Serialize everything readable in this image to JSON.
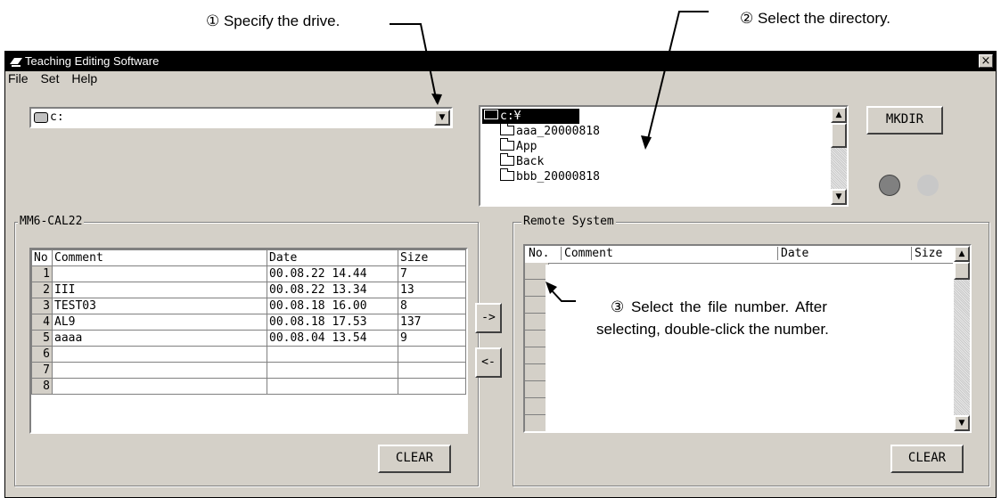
{
  "annotations": {
    "step1": "① Specify the drive.",
    "step2": "② Select the directory.",
    "step3_line1": "③  Select the file number. After",
    "step3_line2": "selecting, double-click the number."
  },
  "window": {
    "title": "Teaching Editing Software",
    "close_glyph": "×"
  },
  "menu": [
    "File",
    "Set",
    "Help"
  ],
  "drive": {
    "value": "c:",
    "arrow": "▼"
  },
  "directory": {
    "root": "c:¥",
    "items": [
      "aaa_20000818",
      "App",
      "Back",
      "bbb_20000818"
    ],
    "up": "▲",
    "down": "▼"
  },
  "mkdir_label": "MKDIR",
  "status_colors": {
    "light1": "#808080",
    "light2": "#c8c8c8"
  },
  "local": {
    "group_label": "MM6-CAL22",
    "columns": [
      "No",
      "Comment",
      "Date",
      "Size"
    ],
    "rows": [
      {
        "no": "1",
        "comment": "",
        "date": "00.08.22 14.44",
        "size": "7"
      },
      {
        "no": "2",
        "comment": "III",
        "date": "00.08.22 13.34",
        "size": "13"
      },
      {
        "no": "3",
        "comment": "TEST03",
        "date": "00.08.18 16.00",
        "size": "8"
      },
      {
        "no": "4",
        "comment": "AL9",
        "date": "00.08.18 17.53",
        "size": "137"
      },
      {
        "no": "5",
        "comment": "aaaa",
        "date": "00.08.04 13.54",
        "size": "9"
      },
      {
        "no": "6",
        "comment": "",
        "date": "",
        "size": ""
      },
      {
        "no": "7",
        "comment": "",
        "date": "",
        "size": ""
      },
      {
        "no": "8",
        "comment": "",
        "date": "",
        "size": ""
      }
    ],
    "clear_label": "CLEAR"
  },
  "transfer": {
    "to_remote": "->",
    "to_local": "<-"
  },
  "remote": {
    "group_label": "Remote System",
    "columns": [
      "No.",
      "Comment",
      "Date",
      "Size"
    ],
    "up": "▲",
    "down": "▼",
    "clear_label": "CLEAR"
  }
}
